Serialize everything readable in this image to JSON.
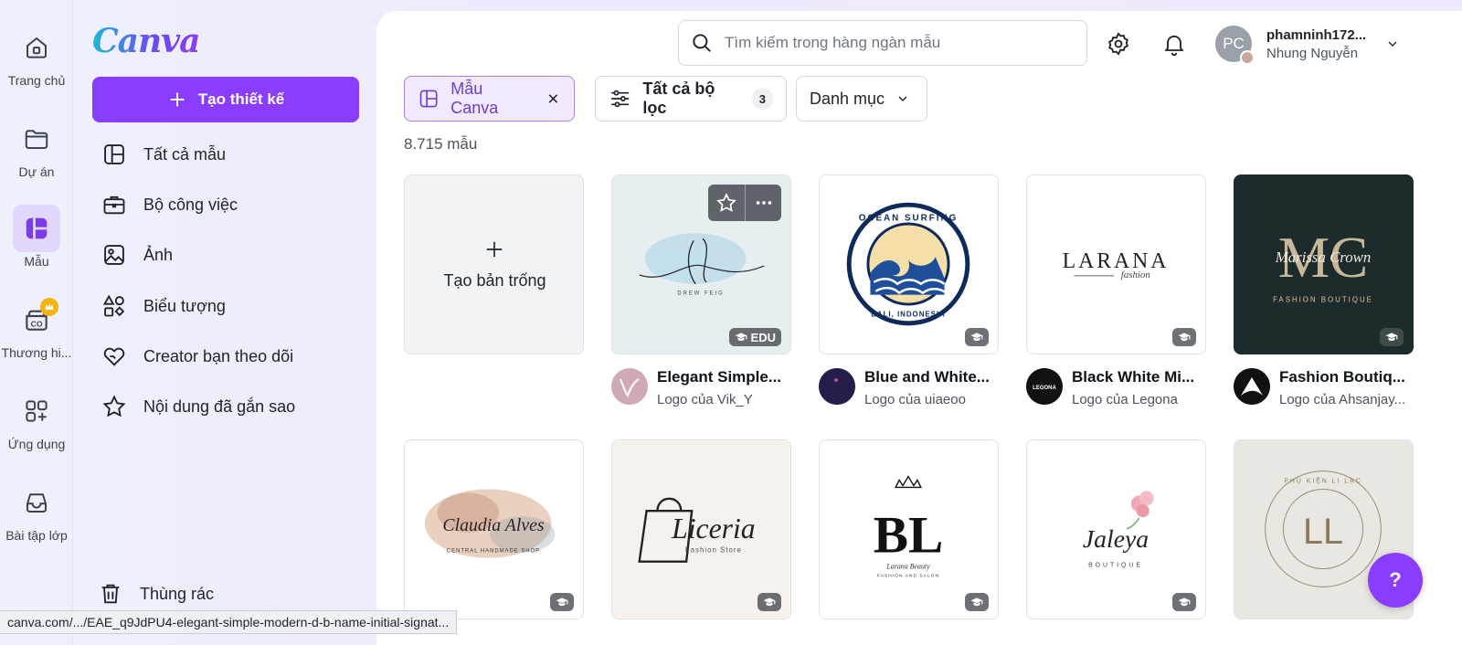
{
  "rail": {
    "items": [
      {
        "label": "Trang chủ",
        "icon": "home-icon"
      },
      {
        "label": "Dự án",
        "icon": "folder-icon"
      },
      {
        "label": "Mẫu",
        "icon": "templates-icon"
      },
      {
        "label": "Thương hi...",
        "icon": "brand-icon"
      },
      {
        "label": "Ứng dụng",
        "icon": "apps-icon"
      },
      {
        "label": "Bài tập lớp",
        "icon": "inbox-icon"
      }
    ]
  },
  "sidebar": {
    "logo": "Canva",
    "create_label": "Tạo thiết kế",
    "items": [
      {
        "label": "Tất cả mẫu",
        "icon": "templates-outline-icon"
      },
      {
        "label": "Bộ công việc",
        "icon": "briefcase-icon"
      },
      {
        "label": "Ảnh",
        "icon": "image-icon"
      },
      {
        "label": "Biểu tượng",
        "icon": "shapes-icon"
      },
      {
        "label": "Creator bạn theo dõi",
        "icon": "heart-hand-icon"
      },
      {
        "label": "Nội dung đã gắn sao",
        "icon": "star-icon"
      }
    ],
    "trash_label": "Thùng rác"
  },
  "header": {
    "search_placeholder": "Tìm kiếm trong hàng ngàn mẫu",
    "user": {
      "initials": "PC",
      "name": "phamninh172...",
      "team": "Nhung Nguyễn"
    }
  },
  "filters": {
    "chip_label": "Mẫu Canva",
    "all_filters_label": "Tất cả bộ lọc",
    "all_filters_count": "3",
    "category_label": "Danh mục"
  },
  "result_count": "8.715 mẫu",
  "blank_card": {
    "label": "Tạo bản trống"
  },
  "cards_row1": [
    {
      "title": "Elegant Simple...",
      "author": "Logo của Vik_Y",
      "badge": "EDU",
      "logo_text": "DREW FEIG"
    },
    {
      "title": "Blue and White...",
      "author": "Logo của uiaeoo",
      "logo_text_top": "OCEAN SURFING",
      "logo_text_bottom": "BALI, INDONESIA"
    },
    {
      "title": "Black White Mi...",
      "author": "Logo của Legona",
      "logo_text": "LARANA",
      "logo_sub": "fashion",
      "avatar_text": "LEGONA"
    },
    {
      "title": "Fashion Boutiq...",
      "author": "Logo của Ahsanjay...",
      "logo_text": "MC",
      "logo_script": "Marissa Crown",
      "logo_sub": "FASHION BOUTIQUE"
    }
  ],
  "cards_row2": [
    {
      "logo_text": "Claudia Alves",
      "logo_sub": "CENTRAL HANDMADE SHOP"
    },
    {
      "logo_text": "Liceria",
      "logo_sub": "Fashion Store"
    },
    {
      "logo_text": "BL",
      "logo_sub": "Larana Beauty",
      "logo_sub2": "FASHION AND SALON"
    },
    {
      "logo_text": "Jaleya",
      "logo_sub": "BOUTIQUE"
    },
    {
      "logo_text": "LL",
      "logo_sub": "PHỤ KIỆN LI LẠC"
    }
  ],
  "help_label": "?",
  "status_url": "canva.com/.../EAE_q9JdPU4-elegant-simple-modern-d-b-name-initial-signat...",
  "colors": {
    "accent": "#8b3dff",
    "selected_chip_bg": "#f1eafe"
  }
}
